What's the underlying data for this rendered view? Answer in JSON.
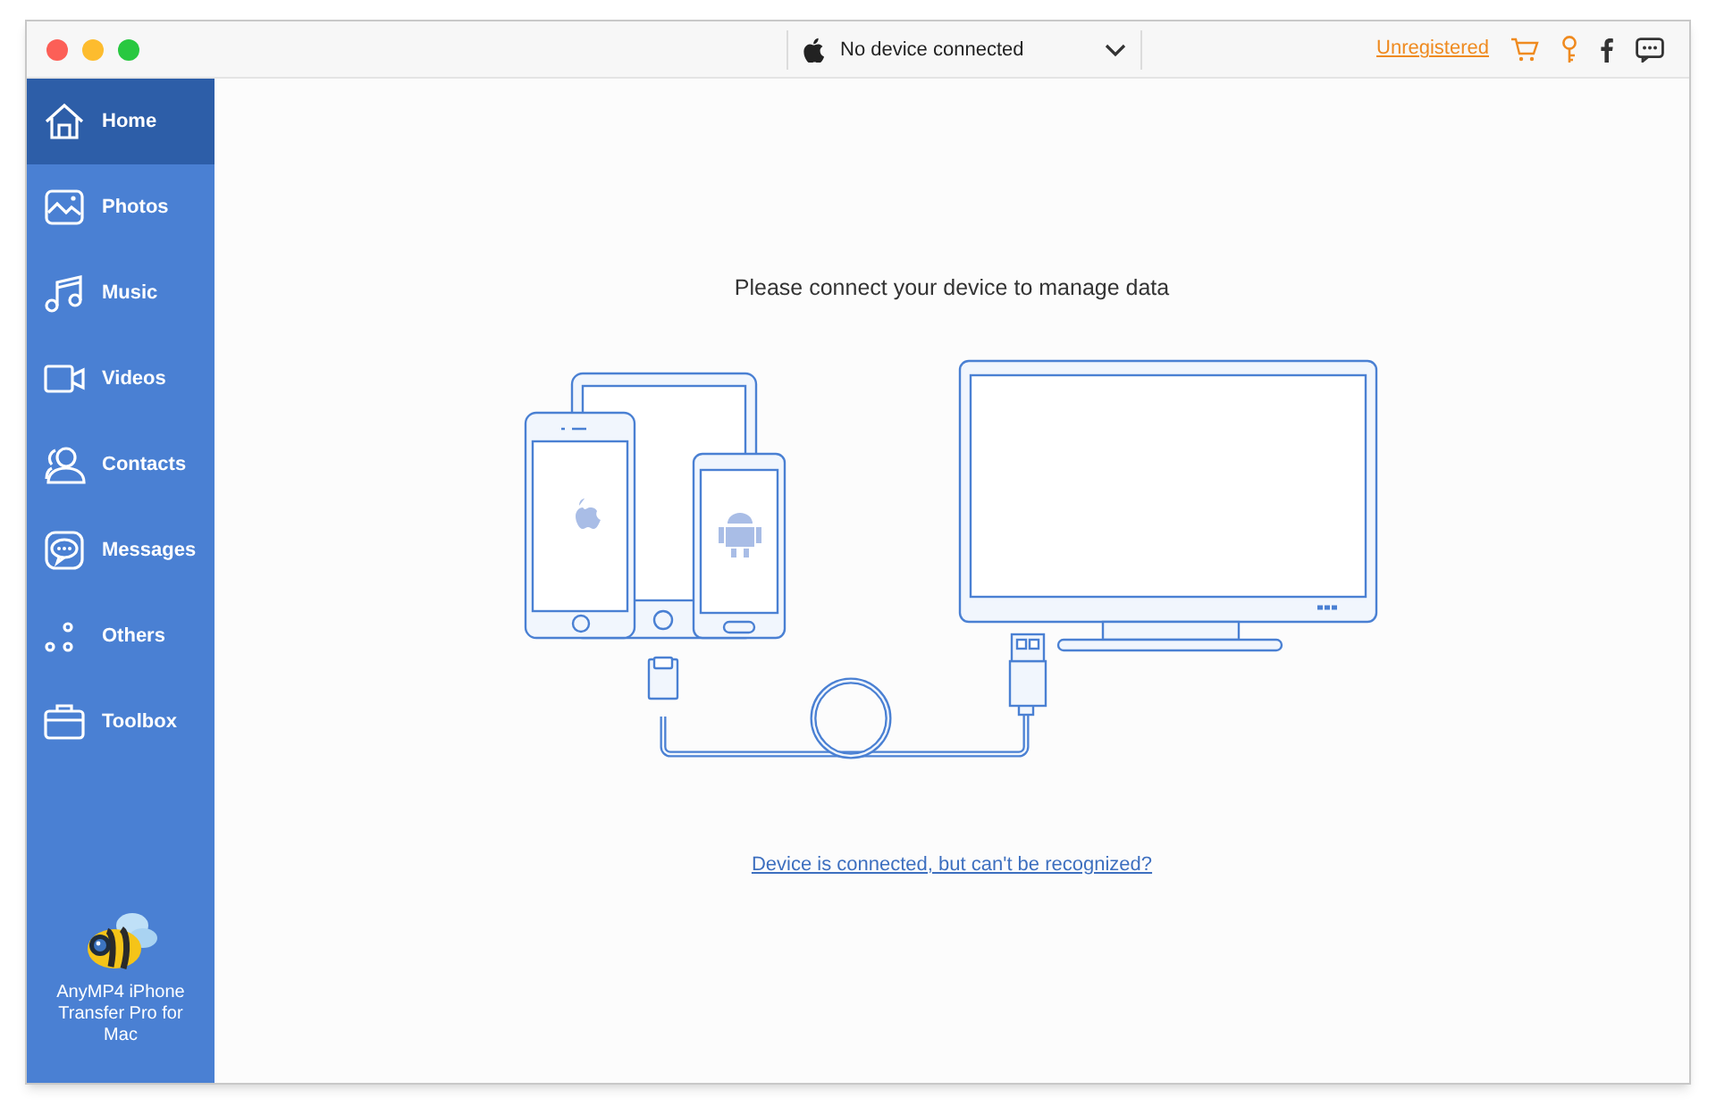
{
  "title_bar": {
    "device_selector": {
      "value": "No device connected"
    },
    "register_link": "Unregistered"
  },
  "sidebar": {
    "items": [
      {
        "label": "Home",
        "selected": true
      },
      {
        "label": "Photos",
        "selected": false
      },
      {
        "label": "Music",
        "selected": false
      },
      {
        "label": "Videos",
        "selected": false
      },
      {
        "label": "Contacts",
        "selected": false
      },
      {
        "label": "Messages",
        "selected": false
      },
      {
        "label": "Others",
        "selected": false
      },
      {
        "label": "Toolbox",
        "selected": false
      }
    ],
    "app_name": "AnyMP4 iPhone Transfer Pro for Mac"
  },
  "main": {
    "prompt": "Please connect your device to manage data",
    "help_link": "Device is connected, but can't be recognized?"
  }
}
